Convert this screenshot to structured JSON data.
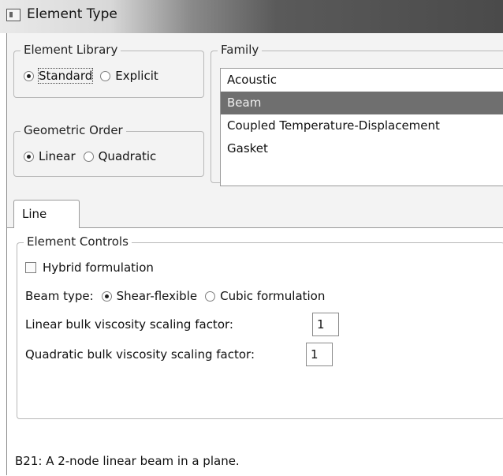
{
  "window": {
    "title": "Element Type"
  },
  "element_library": {
    "legend": "Element Library",
    "options": [
      {
        "label": "Standard",
        "checked": true
      },
      {
        "label": "Explicit",
        "checked": false
      }
    ]
  },
  "geometric_order": {
    "legend": "Geometric Order",
    "options": [
      {
        "label": "Linear",
        "checked": true
      },
      {
        "label": "Quadratic",
        "checked": false
      }
    ]
  },
  "family": {
    "legend": "Family",
    "items": [
      "Acoustic",
      "Beam",
      "Coupled Temperature-Displacement",
      "Gasket"
    ],
    "selected": "Beam"
  },
  "tabs": [
    {
      "label": "Line",
      "active": true
    }
  ],
  "element_controls": {
    "legend": "Element Controls",
    "hybrid_label": "Hybrid formulation",
    "hybrid_checked": false,
    "beam_type_label": "Beam type:",
    "beam_type_options": [
      {
        "label": "Shear-flexible",
        "checked": true
      },
      {
        "label": "Cubic formulation",
        "checked": false
      }
    ],
    "linear_bulk_label": "Linear bulk viscosity scaling factor:",
    "linear_bulk_value": "1",
    "quadratic_bulk_label": "Quadratic bulk viscosity scaling factor:",
    "quadratic_bulk_value": "1"
  },
  "description": "B21:  A 2-node linear beam in a plane."
}
